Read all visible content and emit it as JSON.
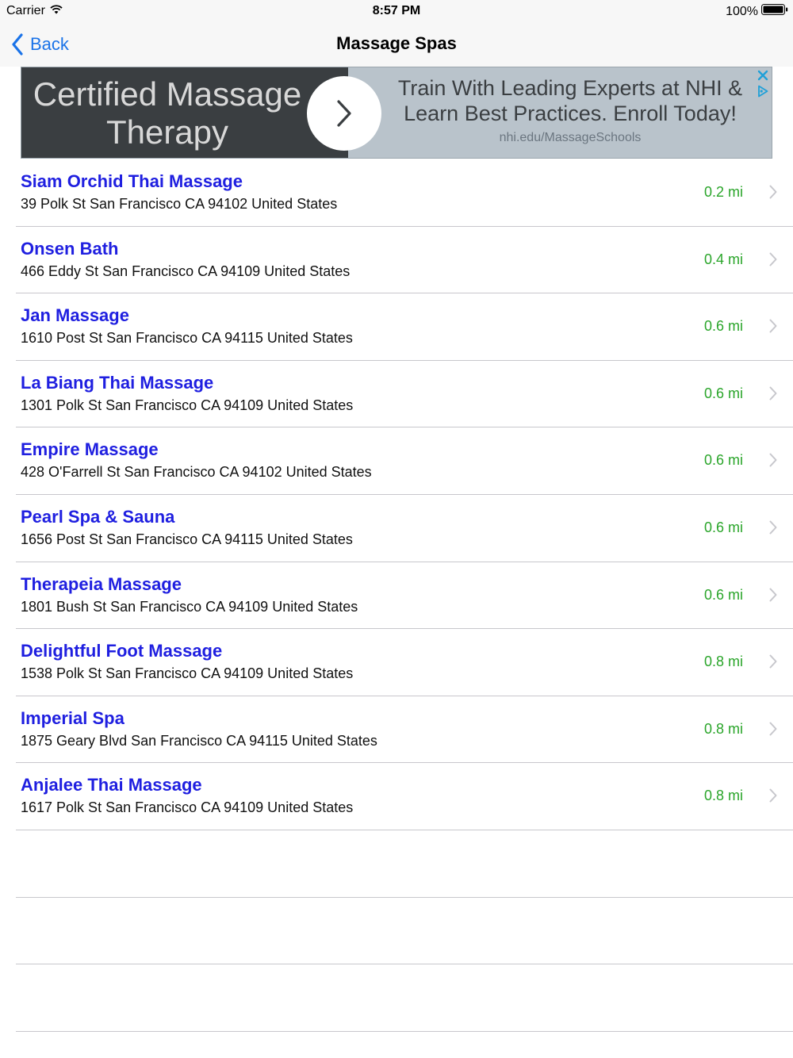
{
  "status_bar": {
    "carrier": "Carrier",
    "time": "8:57 PM",
    "battery": "100%"
  },
  "nav": {
    "back_label": "Back",
    "title": "Massage Spas"
  },
  "ad": {
    "headline": "Certified Massage Therapy",
    "body": "Train With Leading Experts at NHI & Learn Best Practices. Enroll Today!",
    "url": "nhi.edu/MassageSchools"
  },
  "colors": {
    "accent": "#1a73e8",
    "name": "#1f1fe0",
    "distance": "#2aa52a",
    "separator": "#c8c7cc"
  },
  "spas": [
    {
      "name": "Siam Orchid Thai Massage",
      "address": "39 Polk St San Francisco CA 94102 United States",
      "distance": "0.2 mi"
    },
    {
      "name": "Onsen Bath",
      "address": "466 Eddy St San Francisco CA 94109 United States",
      "distance": "0.4 mi"
    },
    {
      "name": "Jan Massage",
      "address": "1610 Post St San Francisco CA 94115 United States",
      "distance": "0.6 mi"
    },
    {
      "name": "La Biang Thai Massage",
      "address": "1301 Polk St San Francisco CA 94109 United States",
      "distance": "0.6 mi"
    },
    {
      "name": "Empire Massage",
      "address": "428 O'Farrell St San Francisco CA 94102 United States",
      "distance": "0.6 mi"
    },
    {
      "name": "Pearl Spa & Sauna",
      "address": "1656 Post St San Francisco CA 94115 United States",
      "distance": "0.6 mi"
    },
    {
      "name": "Therapeia Massage",
      "address": "1801 Bush St San Francisco CA 94109 United States",
      "distance": "0.6 mi"
    },
    {
      "name": "Delightful Foot Massage",
      "address": "1538 Polk St San Francisco CA 94109 United States",
      "distance": "0.8 mi"
    },
    {
      "name": "Imperial Spa",
      "address": "1875 Geary Blvd San Francisco CA 94115 United States",
      "distance": "0.8 mi"
    },
    {
      "name": "Anjalee Thai Massage",
      "address": "1617 Polk St San Francisco CA 94109 United States",
      "distance": "0.8 mi"
    }
  ]
}
